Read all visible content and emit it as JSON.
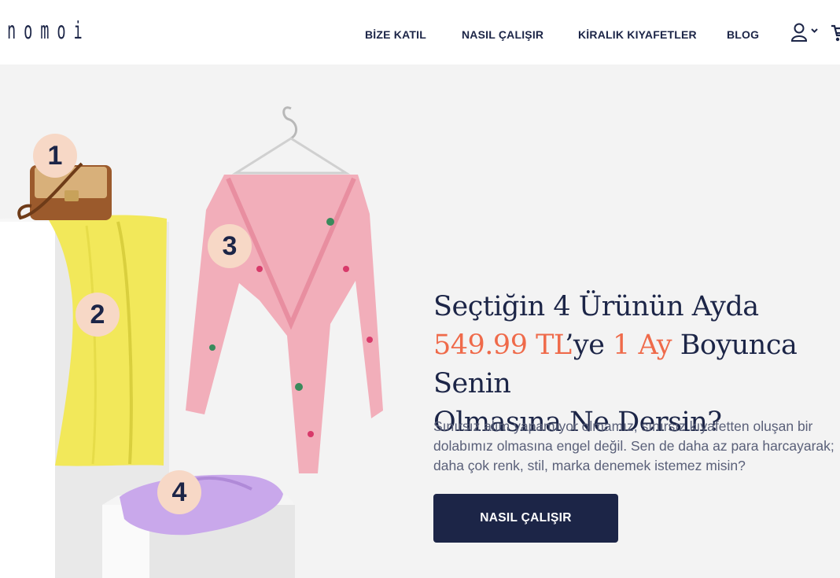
{
  "header": {
    "logo": "nomoi",
    "nav": [
      "BİZE KATIL",
      "NASIL ÇALIŞIR",
      "KİRALIK KIYAFETLER",
      "BLOG"
    ]
  },
  "hero": {
    "badges": [
      "1",
      "2",
      "3",
      "4"
    ],
    "headline": {
      "line1": "Seçtiğin 4 Ürünün Ayda",
      "price": "549.99 TL",
      "price_suffix": "’ye ",
      "duration": "1 Ay",
      "line2_rest": " Boyunca Senin",
      "line3": "Olmasına Ne Dersin?"
    },
    "description_lines": [
      "Sınırsız alım yapamıyor olmamız, sınırsız kıyafetten oluşan bir",
      "dolabımız olmasına engel değil. Sen de daha az para harcayarak;",
      "daha çok renk, stil, marka denemek istemez misin?"
    ],
    "cta_label": "NASIL ÇALIŞIR"
  },
  "colors": {
    "navy": "#1c2547",
    "accent": "#ef6a4a",
    "badge": "#f7d8c6",
    "hero_bg": "#f3f3f3"
  },
  "icons": [
    "user-icon",
    "chevron-down-icon",
    "cart-icon",
    "handbag-icon",
    "hanger-icon"
  ]
}
